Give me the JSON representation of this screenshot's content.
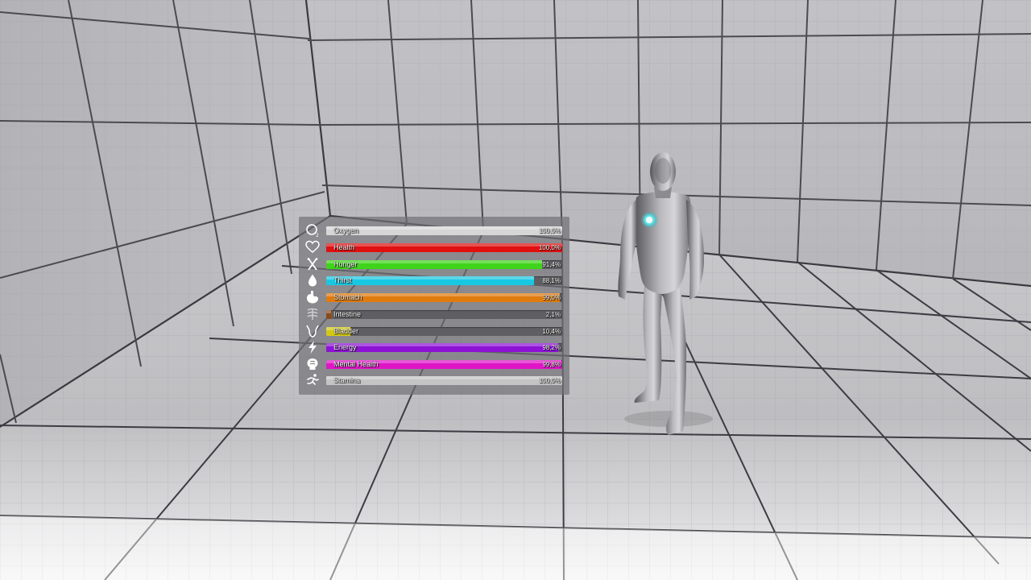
{
  "hud": {
    "stats": [
      {
        "key": "oxygen",
        "label": "Oxygen",
        "value_text": "100,0%",
        "fraction": 1.0,
        "color": "#d6d6d6",
        "icon": "oxygen-icon"
      },
      {
        "key": "health",
        "label": "Health",
        "value_text": "100,0%",
        "fraction": 1.0,
        "color": "#e01010",
        "icon": "heart-icon"
      },
      {
        "key": "hunger",
        "label": "Hunger",
        "value_text": "91,4%",
        "fraction": 0.914,
        "color": "#3fd41b",
        "icon": "hunger-icon"
      },
      {
        "key": "thirst",
        "label": "Thirst",
        "value_text": "88,1%",
        "fraction": 0.881,
        "color": "#18c8e2",
        "icon": "water-drop-icon"
      },
      {
        "key": "stomach",
        "label": "Stomach",
        "value_text": "99,0%",
        "fraction": 0.99,
        "color": "#e07b0d",
        "icon": "stomach-icon"
      },
      {
        "key": "intestine",
        "label": "Intestine",
        "value_text": "2,1%",
        "fraction": 0.021,
        "color": "#8a4b1c",
        "icon": "intestine-icon"
      },
      {
        "key": "bladder",
        "label": "Bladder",
        "value_text": "10,4%",
        "fraction": 0.104,
        "color": "#d2c812",
        "icon": "bladder-icon"
      },
      {
        "key": "energy",
        "label": "Energy",
        "value_text": "98,2%",
        "fraction": 0.982,
        "color": "#8e12d6",
        "icon": "lightning-icon"
      },
      {
        "key": "mental_health",
        "label": "Mental Health",
        "value_text": "99,8%",
        "fraction": 0.998,
        "color": "#df16c6",
        "icon": "brain-icon"
      },
      {
        "key": "stamina",
        "label": "Stamina",
        "value_text": "100,0%",
        "fraction": 1.0,
        "color": "#c4c4c4",
        "icon": "running-icon"
      }
    ]
  }
}
